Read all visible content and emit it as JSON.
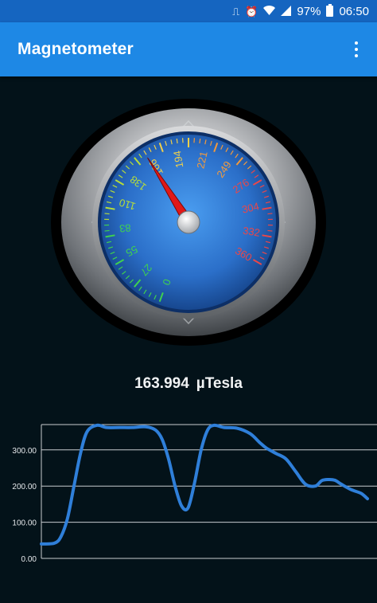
{
  "status_bar": {
    "battery": "97%",
    "time": "06:50",
    "icons": [
      "vibrate-icon",
      "alarm-icon",
      "wifi-icon",
      "signal-icon",
      "battery-icon"
    ]
  },
  "app_bar": {
    "title": "Magnetometer",
    "menu_icon": "overflow-menu-icon"
  },
  "gauge": {
    "ticks": [
      "0",
      "27",
      "55",
      "83",
      "110",
      "138",
      "166",
      "194",
      "221",
      "249",
      "276",
      "304",
      "332",
      "360"
    ],
    "value": 163.994,
    "min": 0,
    "max": 360
  },
  "reading": {
    "value": "163.994",
    "unit": "µTesla"
  },
  "colors": {
    "status_bar": "#1565c0",
    "app_bar": "#1e88e5",
    "background": "#031219",
    "line": "#2f7fd9",
    "needle": "#e01818"
  },
  "chart_data": {
    "type": "line",
    "y_tick_labels": [
      "0.00",
      "100.00",
      "200.00",
      "300.00"
    ],
    "ylim": [
      0,
      370
    ],
    "grid": true,
    "series": [
      {
        "x": [
          0,
          4,
          6,
          8,
          10,
          12,
          14,
          17,
          20,
          24,
          28,
          32,
          35,
          37,
          39,
          41,
          43,
          45,
          47,
          49,
          51,
          53,
          56,
          60,
          64,
          67,
          69,
          72,
          75,
          78,
          81,
          84,
          86,
          88,
          90,
          92,
          95,
          98,
          100
        ],
        "y": [
          40,
          42,
          60,
          110,
          200,
          290,
          350,
          368,
          362,
          362,
          362,
          364,
          355,
          330,
          275,
          200,
          145,
          140,
          210,
          300,
          355,
          368,
          362,
          360,
          345,
          320,
          305,
          290,
          275,
          240,
          205,
          200,
          215,
          218,
          216,
          205,
          190,
          180,
          165
        ]
      }
    ]
  }
}
